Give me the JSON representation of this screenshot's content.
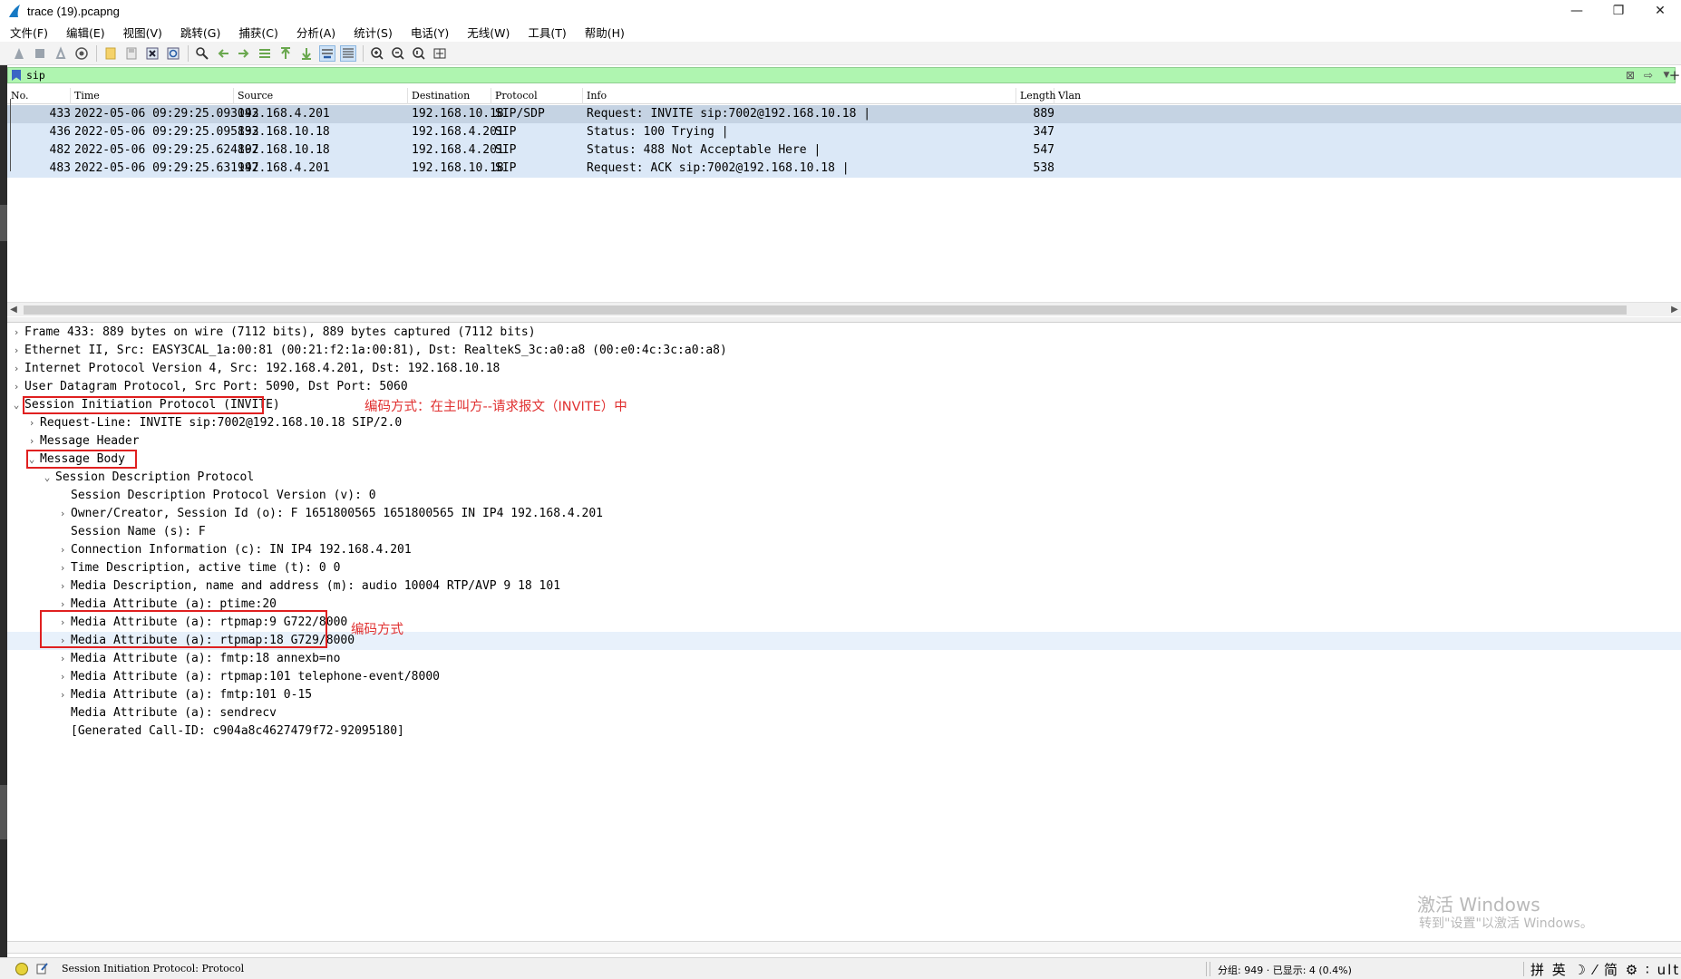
{
  "window": {
    "title": "trace (19).pcapng",
    "minimize": "—",
    "restore": "❐",
    "close": "✕"
  },
  "menu": [
    "文件(F)",
    "编辑(E)",
    "视图(V)",
    "跳转(G)",
    "捕获(C)",
    "分析(A)",
    "统计(S)",
    "电话(Y)",
    "无线(W)",
    "工具(T)",
    "帮助(H)"
  ],
  "filter": {
    "value": "sip",
    "plus": "+"
  },
  "packet_list": {
    "columns": [
      "No.",
      "Time",
      "Source",
      "Destination",
      "Protocol",
      "Info",
      "Length",
      "Vlan"
    ],
    "rows": [
      {
        "no": "433",
        "time": "2022-05-06 09:29:25.093043",
        "source": "192.168.4.201",
        "destination": "192.168.10.18",
        "protocol": "SIP/SDP",
        "info": "Request: INVITE sip:7002@192.168.10.18 |",
        "length": "889"
      },
      {
        "no": "436",
        "time": "2022-05-06 09:29:25.095833",
        "source": "192.168.10.18",
        "destination": "192.168.4.201",
        "protocol": "SIP",
        "info": "Status: 100 Trying |",
        "length": "347"
      },
      {
        "no": "482",
        "time": "2022-05-06 09:29:25.624807",
        "source": "192.168.10.18",
        "destination": "192.168.4.201",
        "protocol": "SIP",
        "info": "Status: 488 Not Acceptable Here |",
        "length": "547"
      },
      {
        "no": "483",
        "time": "2022-05-06 09:29:25.631947",
        "source": "192.168.4.201",
        "destination": "192.168.10.18",
        "protocol": "SIP",
        "info": "Request: ACK sip:7002@192.168.10.18 |",
        "length": "538"
      }
    ]
  },
  "details": [
    {
      "text": "Frame 433: 889 bytes on wire (7112 bits), 889 bytes captured (7112 bits)",
      "toggle": "›"
    },
    {
      "text": "Ethernet II, Src: EASY3CAL_1a:00:81 (00:21:f2:1a:00:81), Dst: RealtekS_3c:a0:a8 (00:e0:4c:3c:a0:a8)",
      "toggle": "›"
    },
    {
      "text": "Internet Protocol Version 4, Src: 192.168.4.201, Dst: 192.168.10.18",
      "toggle": "›"
    },
    {
      "text": "User Datagram Protocol, Src Port: 5090, Dst Port: 5060",
      "toggle": "›"
    },
    {
      "text": "Session Initiation Protocol (INVITE)",
      "toggle": "⌄"
    },
    {
      "text": "Request-Line: INVITE sip:7002@192.168.10.18 SIP/2.0",
      "toggle": "›"
    },
    {
      "text": "Message Header",
      "toggle": "›"
    },
    {
      "text": "Message Body",
      "toggle": "⌄"
    },
    {
      "text": "Session Description Protocol",
      "toggle": "⌄"
    },
    {
      "text": "Session Description Protocol Version (v): 0",
      "toggle": ""
    },
    {
      "text": "Owner/Creator, Session Id (o): F 1651800565 1651800565 IN IP4 192.168.4.201",
      "toggle": "›"
    },
    {
      "text": "Session Name (s): F",
      "toggle": ""
    },
    {
      "text": "Connection Information (c): IN IP4 192.168.4.201",
      "toggle": "›"
    },
    {
      "text": "Time Description, active time (t): 0 0",
      "toggle": "›"
    },
    {
      "text": "Media Description, name and address (m): audio 10004 RTP/AVP 9 18 101",
      "toggle": "›"
    },
    {
      "text": "Media Attribute (a): ptime:20",
      "toggle": "›"
    },
    {
      "text": "Media Attribute (a): rtpmap:9 G722/8000",
      "toggle": "›"
    },
    {
      "text": "Media Attribute (a): rtpmap:18 G729/8000",
      "toggle": "›"
    },
    {
      "text": "Media Attribute (a): fmtp:18 annexb=no",
      "toggle": "›"
    },
    {
      "text": "Media Attribute (a): rtpmap:101 telephone-event/8000",
      "toggle": "›"
    },
    {
      "text": "Media Attribute (a): fmtp:101 0-15",
      "toggle": "›"
    },
    {
      "text": "Media Attribute (a): sendrecv",
      "toggle": ""
    },
    {
      "text": "[Generated Call-ID: c904a8c4627479f72-92095180]",
      "toggle": ""
    }
  ],
  "annotations": {
    "invite_note": "编码方式：在主叫方--请求报文（INVITE）中",
    "codec_note": "编码方式",
    "color": "#e02020"
  },
  "watermark": {
    "line1": "激活 Windows",
    "line2": "转到\"设置\"以激活 Windows。"
  },
  "status": {
    "text": "Session Initiation Protocol: Protocol",
    "stats": "分组: 949 · 已显示: 4 (0.4%)",
    "ime": "拼 英 ☽ ⁄ 简 ⚙ ∶ ult"
  },
  "colors": {
    "filter_ok": "#aff5b0",
    "row_bg": "#dbe8f7",
    "row_selected": "#c5d3e3"
  }
}
